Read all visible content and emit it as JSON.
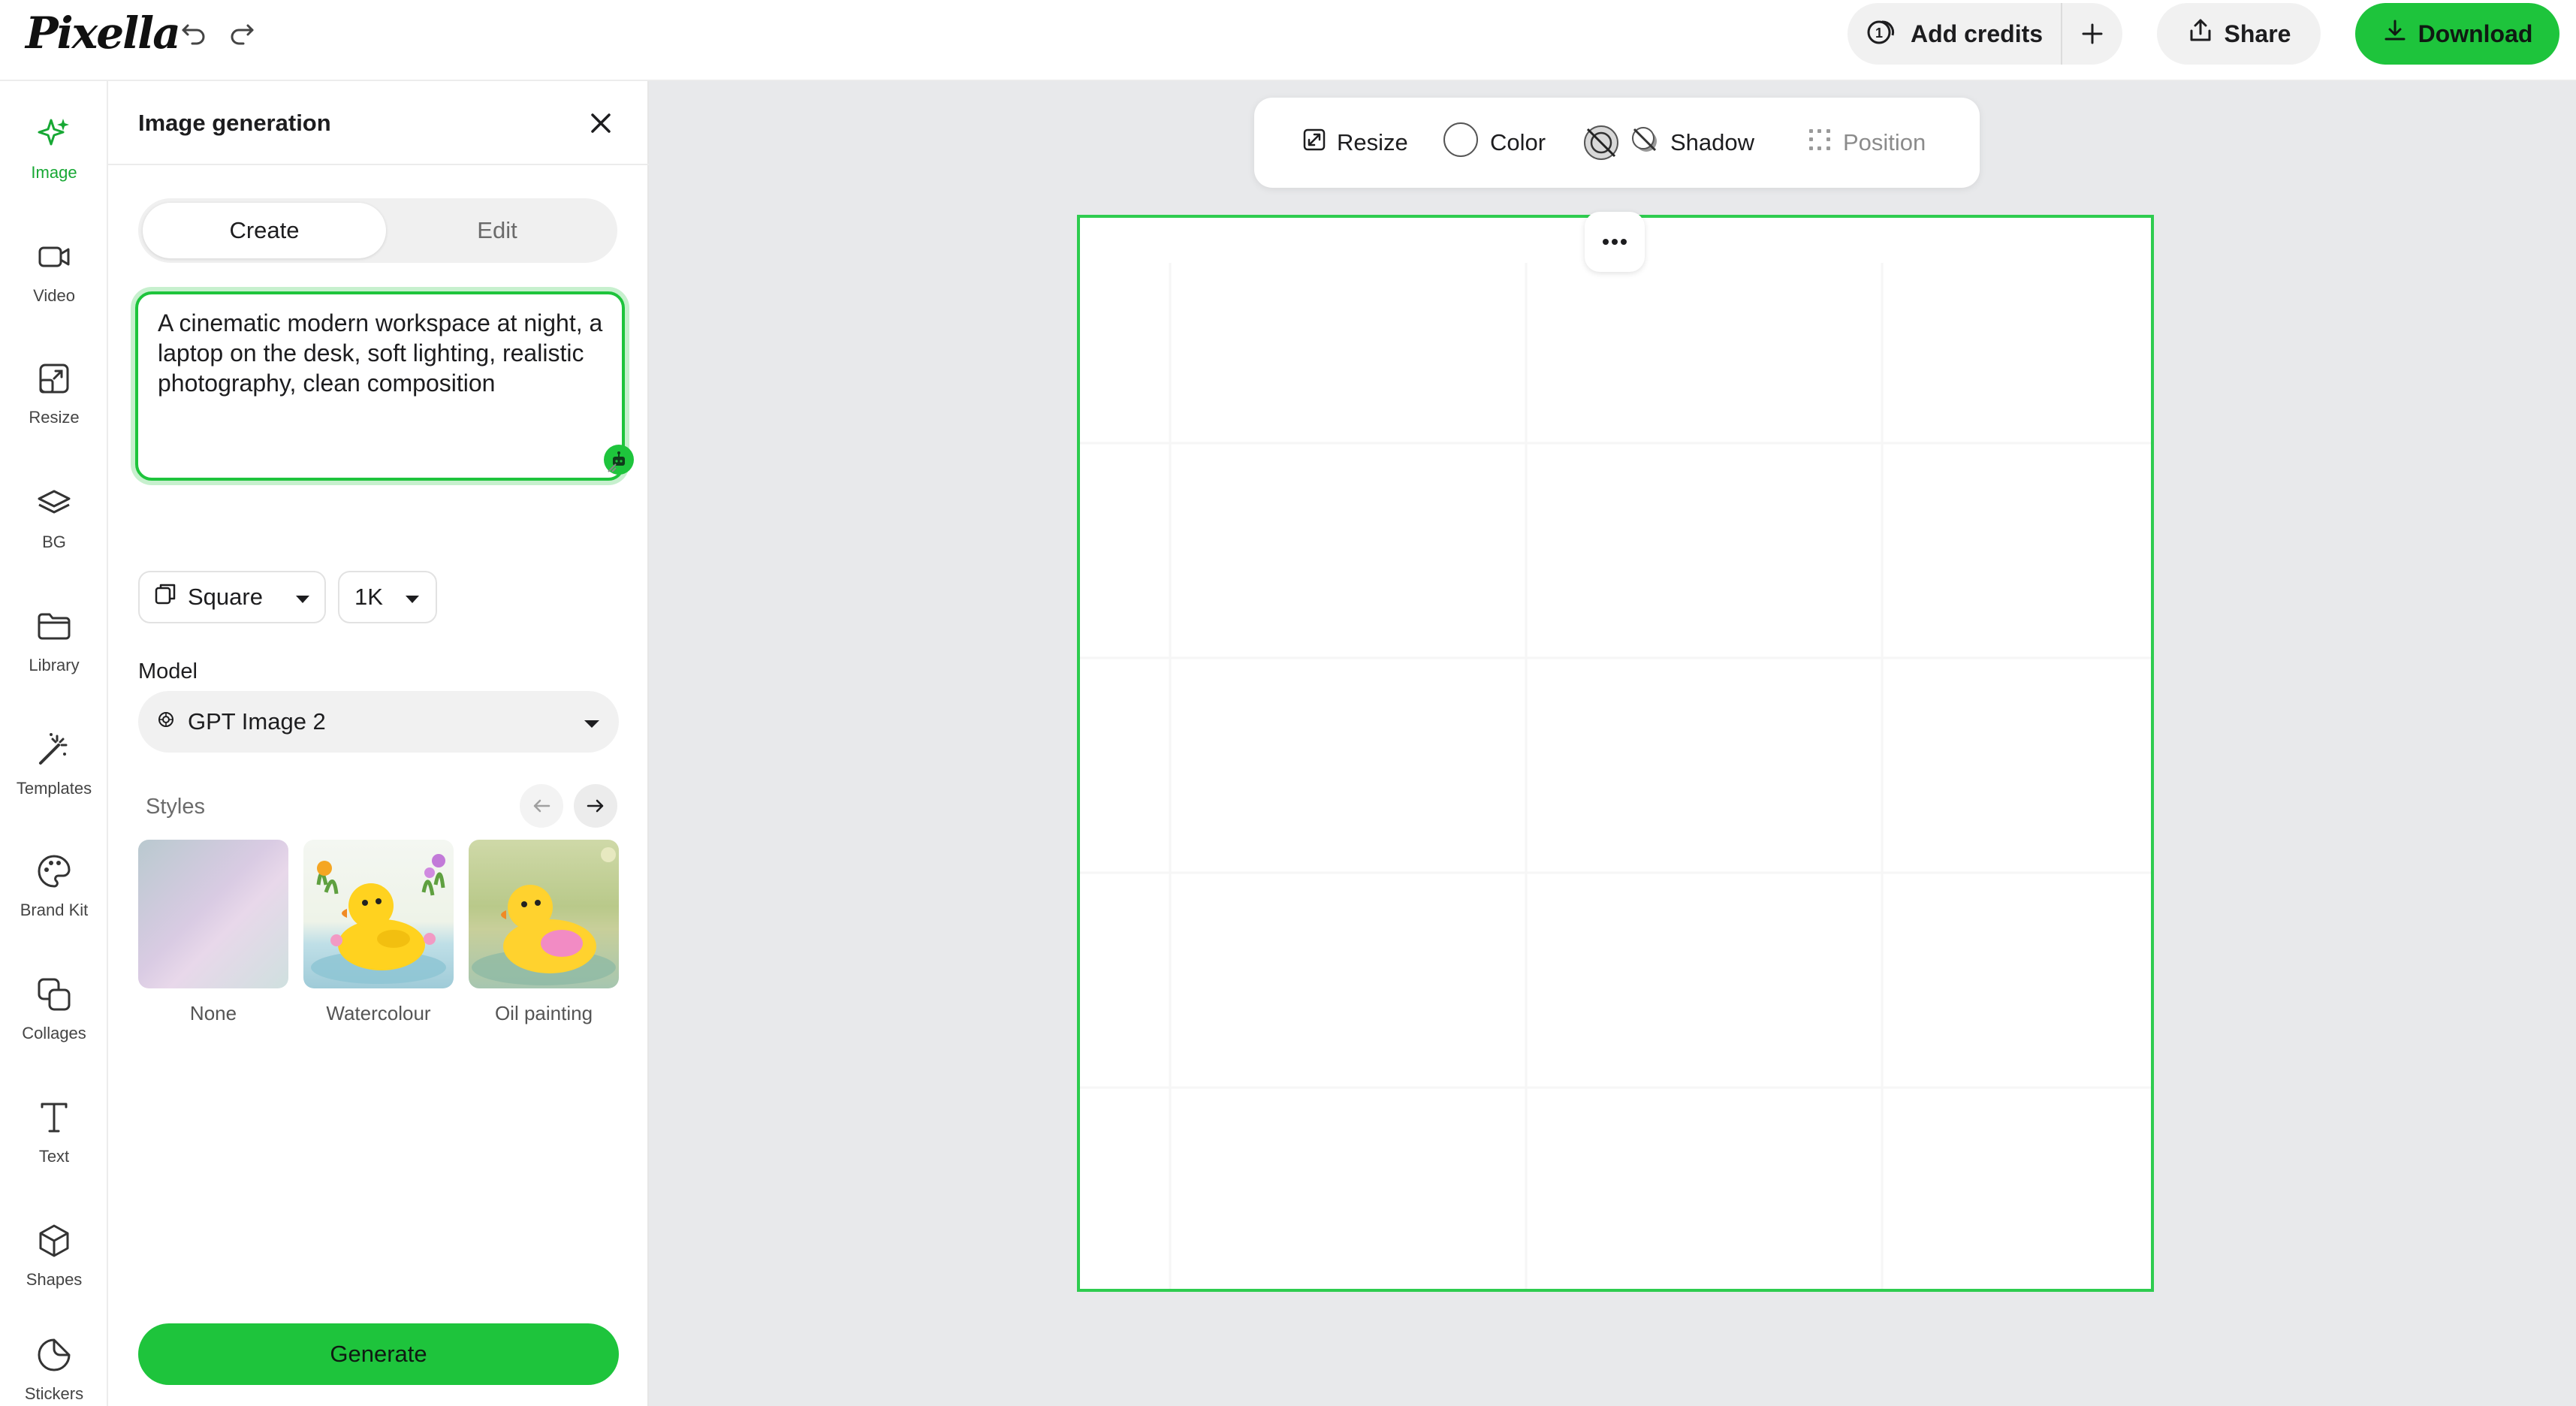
{
  "app": {
    "logo": "Pixella"
  },
  "header": {
    "add_credits": "Add credits",
    "share": "Share",
    "download": "Download"
  },
  "rail": {
    "items": [
      {
        "label": "Image",
        "icon": "sparkle-icon",
        "active": true
      },
      {
        "label": "Video",
        "icon": "video-icon"
      },
      {
        "label": "Resize",
        "icon": "resize-icon"
      },
      {
        "label": "BG",
        "icon": "layers-icon"
      },
      {
        "label": "Library",
        "icon": "folder-icon"
      },
      {
        "label": "Templates",
        "icon": "magic-wand-icon"
      },
      {
        "label": "Brand Kit",
        "icon": "palette-icon"
      },
      {
        "label": "Collages",
        "icon": "collage-icon"
      },
      {
        "label": "Text",
        "icon": "text-icon"
      },
      {
        "label": "Shapes",
        "icon": "cube-icon"
      },
      {
        "label": "Stickers",
        "icon": "sticker-icon"
      }
    ]
  },
  "panel": {
    "title": "Image generation",
    "tabs": {
      "create": "Create",
      "edit": "Edit",
      "active": "create"
    },
    "prompt": "A cinematic modern workspace at night, a laptop on the desk, soft lighting, realistic photography, clean composition",
    "aspect": "Square",
    "resolution": "1K",
    "model_label": "Model",
    "model": "GPT Image 2",
    "styles_label": "Styles",
    "styles": [
      {
        "name": "None"
      },
      {
        "name": "Watercolour"
      },
      {
        "name": "Oil painting"
      }
    ],
    "generate": "Generate"
  },
  "toolbar": {
    "resize": "Resize",
    "color": "Color",
    "shadow": "Shadow",
    "position": "Position"
  },
  "colors": {
    "accent": "#1ec43c",
    "canvas_border": "#2ecc4f",
    "workspace_bg": "#e8e9eb"
  }
}
